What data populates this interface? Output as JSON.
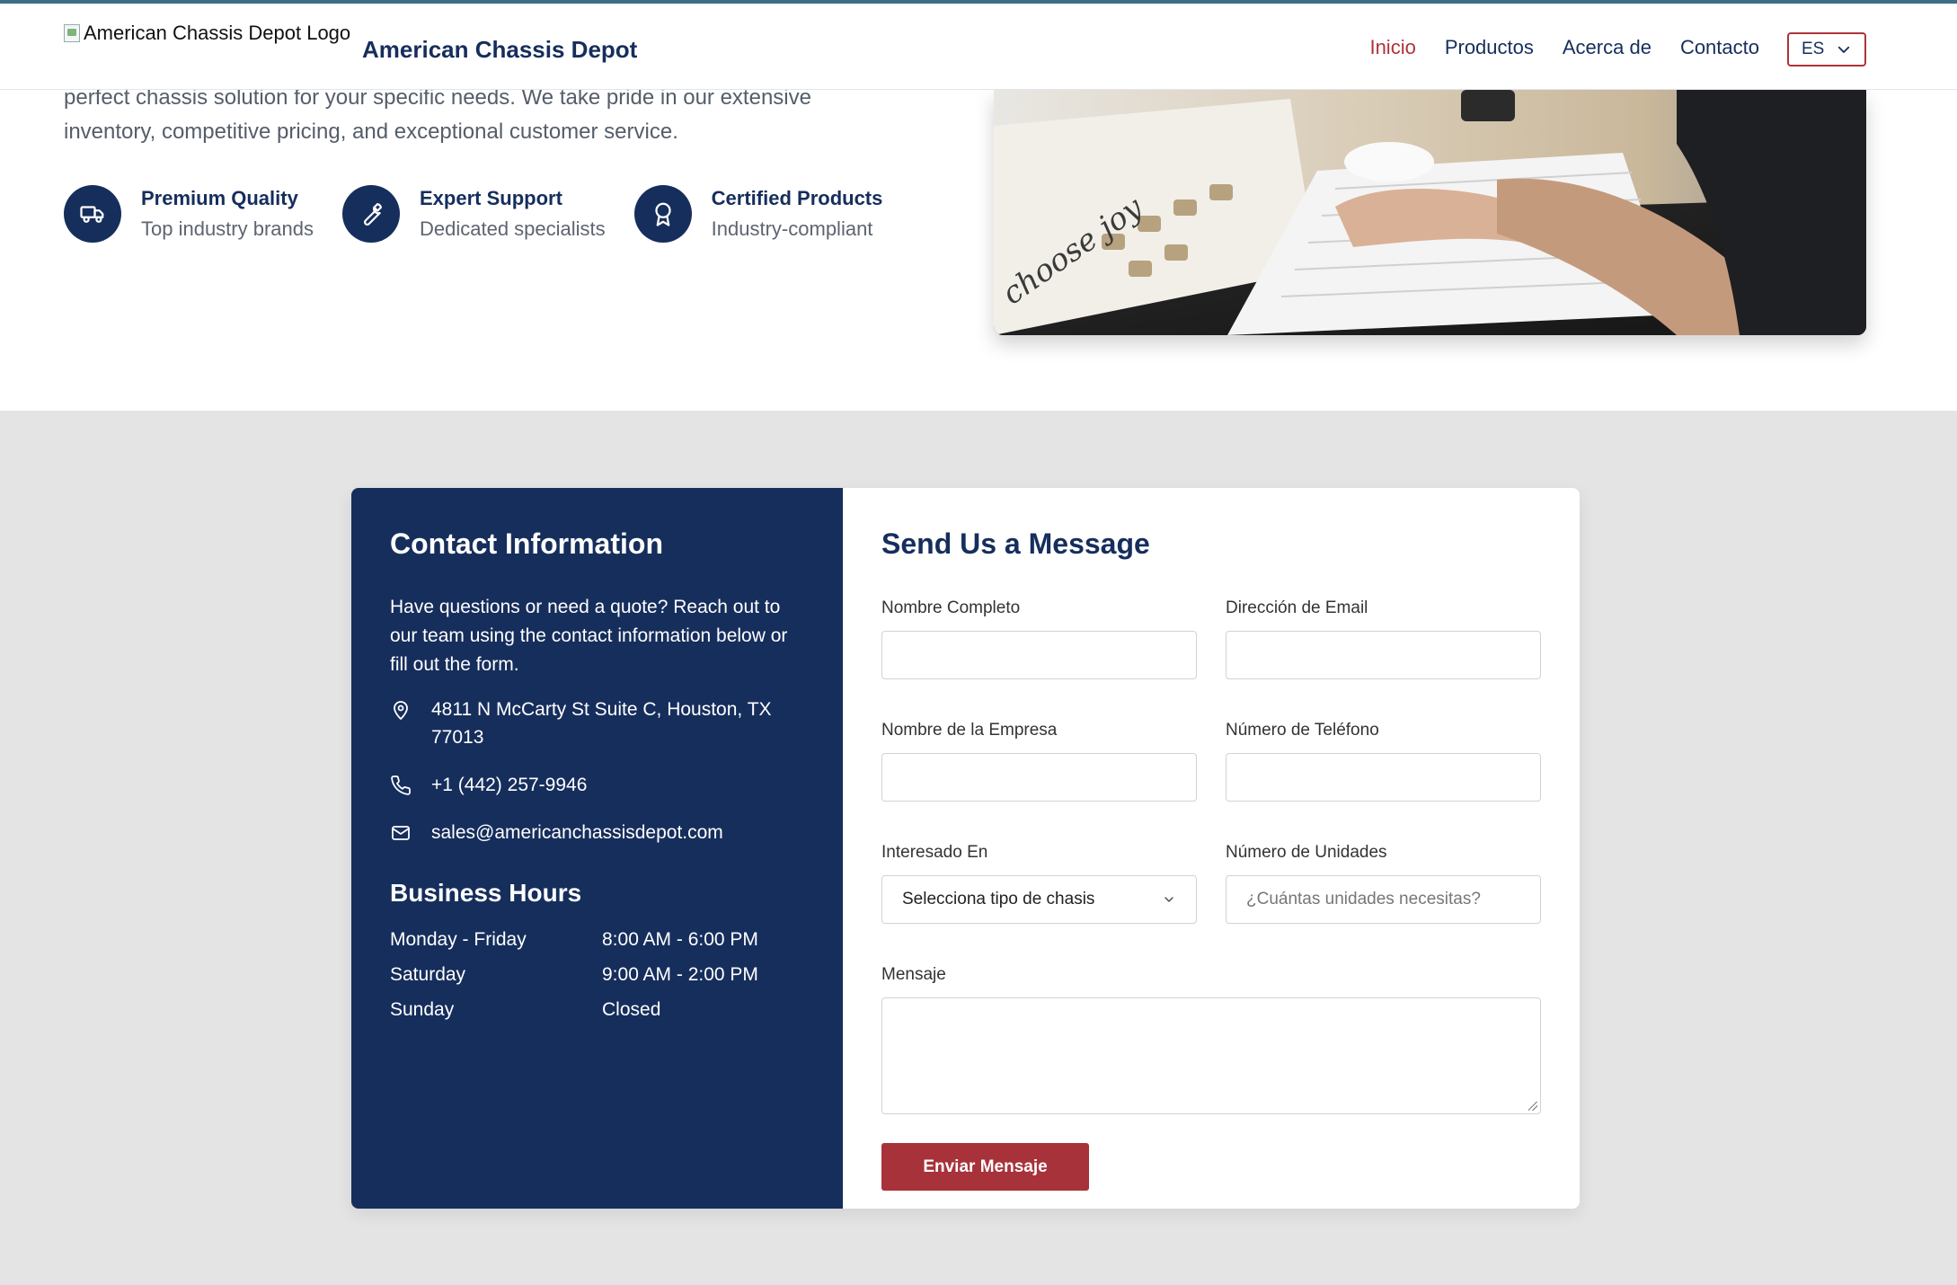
{
  "header": {
    "logo_alt": "American Chassis Depot Logo",
    "brand": "American Chassis Depot",
    "nav": [
      {
        "label": "Inicio",
        "active": true
      },
      {
        "label": "Productos",
        "active": false
      },
      {
        "label": "Acerca de",
        "active": false
      },
      {
        "label": "Contacto",
        "active": false
      }
    ],
    "language": "ES"
  },
  "intro": {
    "text_line1": "perfect chassis solution for your specific needs. We take pride in our extensive",
    "text_line2": "inventory, competitive pricing, and exceptional customer service."
  },
  "features": [
    {
      "icon": "truck-icon",
      "title": "Premium Quality",
      "subtitle": "Top industry brands"
    },
    {
      "icon": "wrench-icon",
      "title": "Expert Support",
      "subtitle": "Dedicated specialists"
    },
    {
      "icon": "award-icon",
      "title": "Certified Products",
      "subtitle": "Industry-compliant"
    }
  ],
  "contact_info": {
    "title": "Contact Information",
    "description": "Have questions or need a quote? Reach out to our team using the contact information below or fill out the form.",
    "address": "4811 N McCarty St Suite C, Houston, TX 77013",
    "phone": "+1 (442) 257-9946",
    "email": "sales@americanchassisdepot.com",
    "hours_title": "Business Hours",
    "hours": [
      {
        "day": "Monday - Friday",
        "time": "8:00 AM - 6:00 PM"
      },
      {
        "day": "Saturday",
        "time": "9:00 AM - 2:00 PM"
      },
      {
        "day": "Sunday",
        "time": "Closed"
      }
    ]
  },
  "form": {
    "title": "Send Us a Message",
    "full_name_label": "Nombre Completo",
    "email_label": "Dirección de Email",
    "company_label": "Nombre de la Empresa",
    "phone_label": "Número de Teléfono",
    "interest_label": "Interesado En",
    "interest_value": "Selecciona tipo de chasis",
    "units_label": "Número de Unidades",
    "units_placeholder": "¿Cuántas unidades necesitas?",
    "message_label": "Mensaje",
    "submit_label": "Enviar Mensaje"
  },
  "colors": {
    "navy": "#162e5c",
    "accent_red": "#a8323a",
    "section_gray": "#e4e4e4",
    "top_border": "#3a6f85"
  }
}
